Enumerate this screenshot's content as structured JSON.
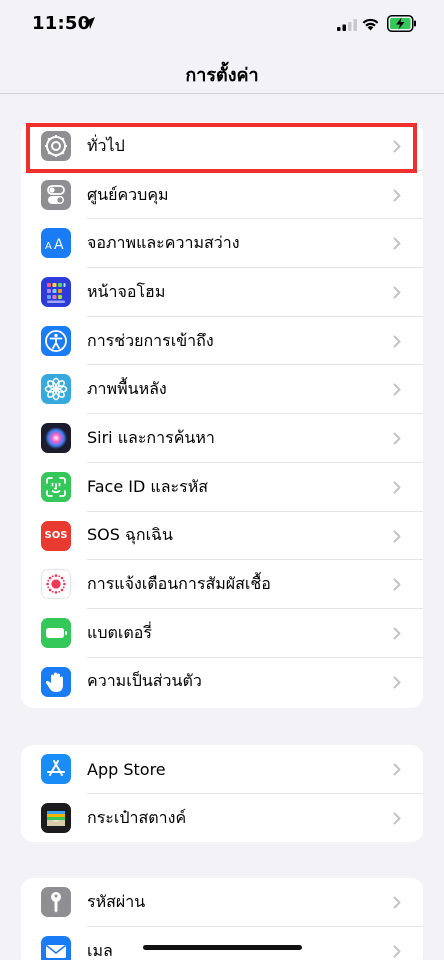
{
  "status": {
    "time": "11:50"
  },
  "nav": {
    "title": "การตั้งค่า"
  },
  "groups": [
    {
      "items": [
        {
          "label": "ทั่วไป",
          "icon": "gear-icon",
          "color": "#8e8e93"
        },
        {
          "label": "ศูนย์ควบคุม",
          "icon": "toggles-icon",
          "color": "#8e8e93"
        },
        {
          "label": "จอภาพและความสว่าง",
          "icon": "text-size-icon",
          "color": "#1a7cf5"
        },
        {
          "label": "หน้าจอโฮม",
          "icon": "home-grid-icon",
          "color": "#2d3cd9"
        },
        {
          "label": "การช่วยการเข้าถึง",
          "icon": "accessibility-icon",
          "color": "#1a7cf5"
        },
        {
          "label": "ภาพพื้นหลัง",
          "icon": "wallpaper-flower-icon",
          "color": "#36aadc"
        },
        {
          "label": "Siri และการค้นหา",
          "icon": "siri-icon",
          "color": "#1c1c2e"
        },
        {
          "label": "Face ID และรหัส",
          "icon": "face-id-icon",
          "color": "#34c759"
        },
        {
          "label": "SOS ฉุกเฉิน",
          "icon": "sos-icon",
          "color": "#e83a30",
          "icon_text": "SOS"
        },
        {
          "label": "การแจ้งเตือนการสัมผัสเชื้อ",
          "icon": "exposure-notification-icon",
          "color": "#ffffff"
        },
        {
          "label": "แบตเตอรี่",
          "icon": "battery-icon",
          "color": "#34c759"
        },
        {
          "label": "ความเป็นส่วนตัว",
          "icon": "hand-icon",
          "color": "#1a7cf5"
        }
      ]
    },
    {
      "items": [
        {
          "label": "App Store",
          "icon": "app-store-icon",
          "color": "#1a8cf5"
        },
        {
          "label": "กระเป๋าสตางค์",
          "icon": "wallet-icon",
          "color": "#1c1c1e"
        }
      ]
    },
    {
      "items": [
        {
          "label": "รหัสผ่าน",
          "icon": "key-icon",
          "color": "#8e8e93"
        },
        {
          "label": "เมล",
          "icon": "mail-icon",
          "color": "#1a7cf5"
        }
      ]
    }
  ]
}
